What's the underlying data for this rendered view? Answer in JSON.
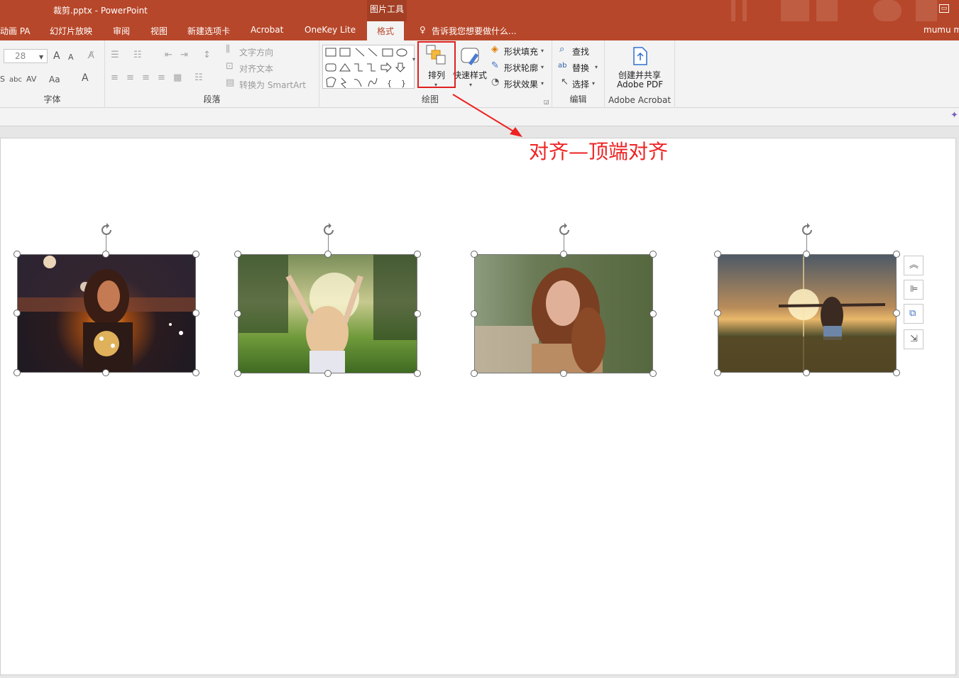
{
  "window": {
    "title": "裁剪.pptx - PowerPoint",
    "context_label": "图片工具",
    "user": "mumu m"
  },
  "tabs": [
    {
      "label": "动画 PA"
    },
    {
      "label": "幻灯片放映"
    },
    {
      "label": "审阅"
    },
    {
      "label": "视图"
    },
    {
      "label": "新建选项卡"
    },
    {
      "label": "Acrobat"
    },
    {
      "label": "OneKey Lite"
    },
    {
      "label": "格式"
    }
  ],
  "tell_me": "告诉我您想要做什么...",
  "font_group": {
    "label": "字体",
    "size": "28",
    "grow": "A",
    "shrink": "A",
    "abc": "abc",
    "spacing": "AV",
    "case": "Aa",
    "color": "A"
  },
  "paragraph_group": {
    "label": "段落",
    "text_direction": "文字方向",
    "align_text": "对齐文本",
    "convert": "转换为 SmartArt"
  },
  "drawing_group": {
    "label": "绘图",
    "arrange": "排列",
    "quick_styles": "快速样式",
    "fill": "形状填充",
    "outline": "形状轮廓",
    "effects": "形状效果"
  },
  "editing_group": {
    "label": "编辑",
    "find": "查找",
    "replace": "替换",
    "select": "选择"
  },
  "acrobat_group": {
    "label": "Adobe Acrobat",
    "create_line1": "创建并共享",
    "create_line2": "Adobe PDF"
  },
  "annotation": "对齐—顶端对齐",
  "colors": {
    "accent": "#b7472a",
    "annotation": "#ee2222"
  }
}
